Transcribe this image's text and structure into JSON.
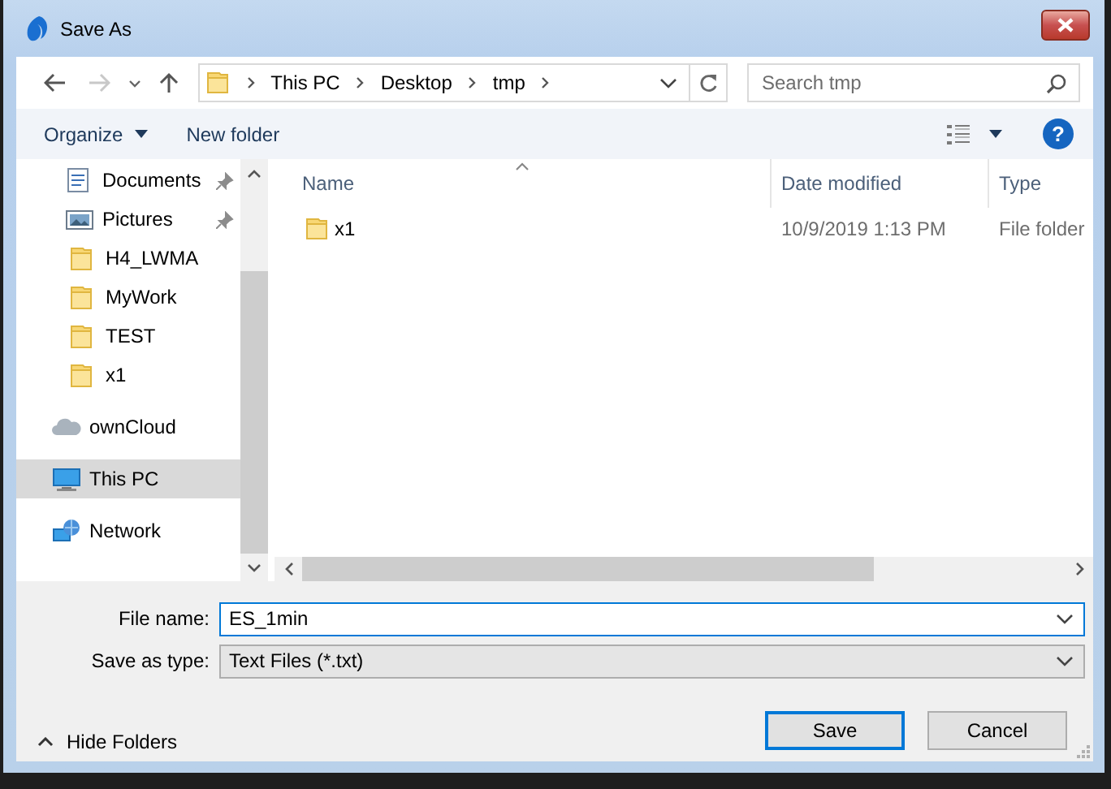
{
  "window": {
    "title": "Save As"
  },
  "address": {
    "path": [
      "This PC",
      "Desktop",
      "tmp"
    ]
  },
  "search": {
    "placeholder": "Search tmp"
  },
  "toolbar": {
    "organize": "Organize",
    "new_folder": "New folder",
    "help": "?"
  },
  "sidebar": {
    "items": [
      {
        "label": "Documents",
        "kind": "documents",
        "pinned": true,
        "selected": false
      },
      {
        "label": "Pictures",
        "kind": "pictures",
        "pinned": true,
        "selected": false
      },
      {
        "label": "H4_LWMA",
        "kind": "folder",
        "pinned": false,
        "selected": false
      },
      {
        "label": "MyWork",
        "kind": "folder",
        "pinned": false,
        "selected": false
      },
      {
        "label": "TEST",
        "kind": "folder",
        "pinned": false,
        "selected": false
      },
      {
        "label": "x1",
        "kind": "folder",
        "pinned": false,
        "selected": false
      },
      {
        "label": "ownCloud",
        "kind": "cloud",
        "pinned": false,
        "selected": false
      },
      {
        "label": "This PC",
        "kind": "pc",
        "pinned": false,
        "selected": true
      },
      {
        "label": "Network",
        "kind": "network",
        "pinned": false,
        "selected": false
      }
    ]
  },
  "file_list": {
    "columns": [
      {
        "label": "Name",
        "sorted": true
      },
      {
        "label": "Date modified",
        "sorted": false
      },
      {
        "label": "Type",
        "sorted": false
      }
    ],
    "rows": [
      {
        "name": "x1",
        "date": "10/9/2019 1:13 PM",
        "type": "File folder",
        "selected": false
      }
    ]
  },
  "file_name": {
    "label": "File name:",
    "value": "ES_1min"
  },
  "save_type": {
    "label": "Save as type:",
    "value": "Text Files (*.txt)"
  },
  "hide_folders": {
    "label": "Hide Folders"
  },
  "buttons": [
    {
      "label": "Save",
      "default": true
    },
    {
      "label": "Cancel",
      "default": false
    }
  ]
}
